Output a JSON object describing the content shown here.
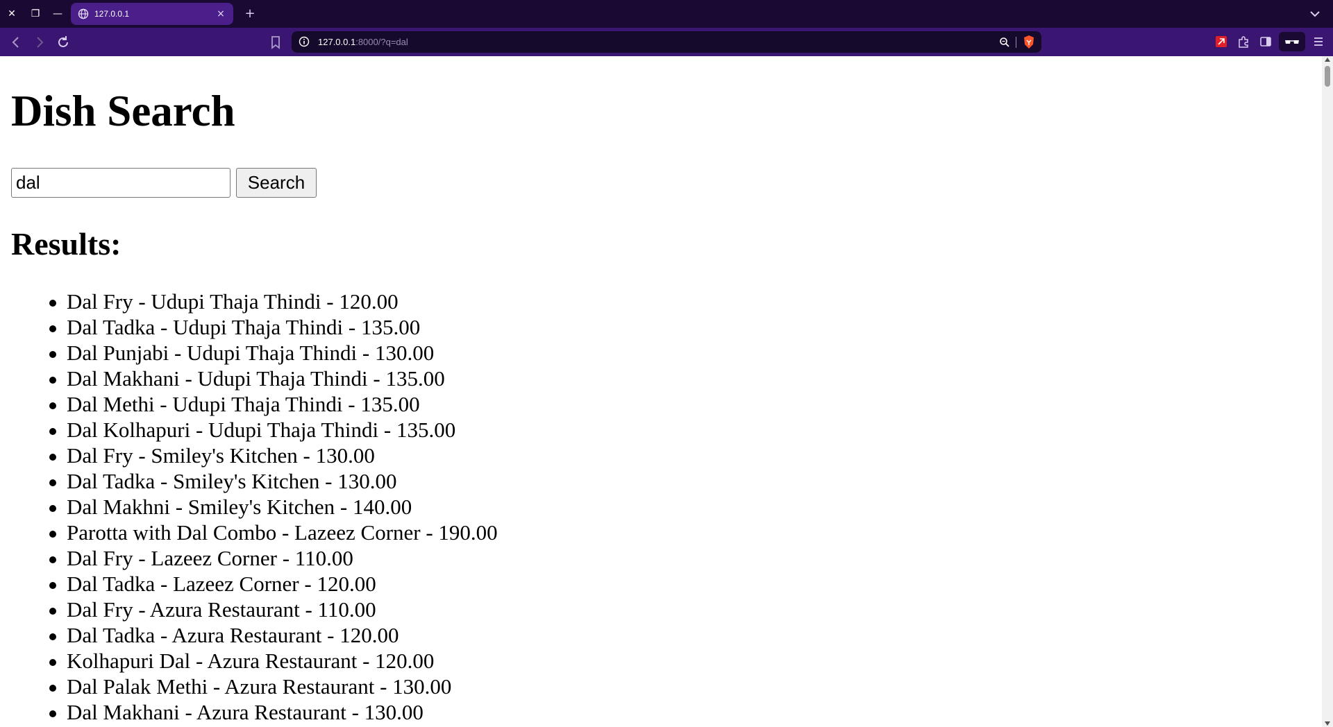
{
  "browser": {
    "tab": {
      "title": "127.0.0.1",
      "close_label": "×"
    },
    "new_tab_label": "+",
    "window_buttons": {
      "close": "✕",
      "restore": "❐",
      "minimize": "—"
    },
    "url": {
      "host": "127.0.0.1",
      "rest": ":8000/?q=dal"
    },
    "accent_color": "#3b1572",
    "tabbar_color": "#1a0a33"
  },
  "page": {
    "title": "Dish Search",
    "search": {
      "value": "dal",
      "button_label": "Search"
    },
    "results_heading": "Results:",
    "results": [
      "Dal Fry - Udupi Thaja Thindi - 120.00",
      "Dal Tadka - Udupi Thaja Thindi - 135.00",
      "Dal Punjabi - Udupi Thaja Thindi - 130.00",
      "Dal Makhani - Udupi Thaja Thindi - 135.00",
      "Dal Methi - Udupi Thaja Thindi - 135.00",
      "Dal Kolhapuri - Udupi Thaja Thindi - 135.00",
      "Dal Fry - Smiley's Kitchen - 130.00",
      "Dal Tadka - Smiley's Kitchen - 130.00",
      "Dal Makhni - Smiley's Kitchen - 140.00",
      "Parotta with Dal Combo - Lazeez Corner - 190.00",
      "Dal Fry - Lazeez Corner - 110.00",
      "Dal Tadka - Lazeez Corner - 120.00",
      "Dal Fry - Azura Restaurant - 110.00",
      "Dal Tadka - Azura Restaurant - 120.00",
      "Kolhapuri Dal - Azura Restaurant - 120.00",
      "Dal Palak Methi - Azura Restaurant - 130.00",
      "Dal Makhani - Azura Restaurant - 130.00"
    ]
  }
}
